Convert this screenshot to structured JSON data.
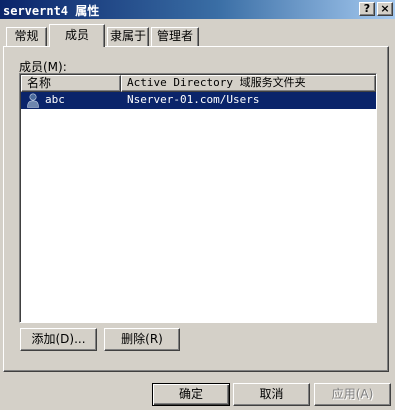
{
  "window": {
    "title": "servernt4 属性",
    "help_glyph": "?",
    "close_glyph": "×"
  },
  "tabs": [
    {
      "label": "常规",
      "selected": false
    },
    {
      "label": "成员",
      "selected": true
    },
    {
      "label": "隶属于",
      "selected": false
    },
    {
      "label": "管理者",
      "selected": false
    }
  ],
  "members": {
    "label": "成员(M):",
    "columns": [
      "名称",
      "Active Directory 域服务文件夹"
    ],
    "rows": [
      {
        "name": "abc",
        "folder": "Nserver-01.com/Users",
        "icon": "user-icon",
        "selected": true
      }
    ]
  },
  "panel_buttons": {
    "add_label": "添加(D)...",
    "remove_label": "删除(R)"
  },
  "dialog_buttons": {
    "ok_label": "确定",
    "cancel_label": "取消",
    "apply_label": "应用(A)",
    "apply_enabled": false
  },
  "colors": {
    "selection": "#0a246a",
    "face": "#d4d0c8",
    "title_start": "#0a246a",
    "title_end": "#a6caf0"
  }
}
